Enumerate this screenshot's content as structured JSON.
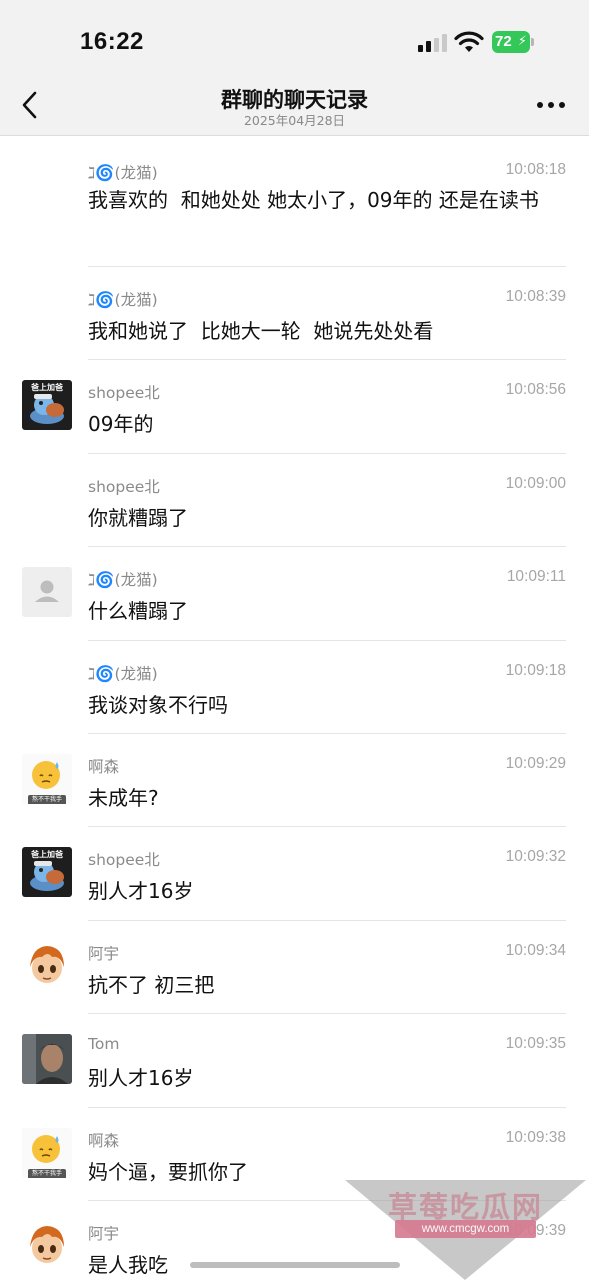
{
  "status_bar": {
    "time": "16:22",
    "battery": "72"
  },
  "nav": {
    "title": "群聊的聊天记录",
    "subtitle": "2025年04月28日"
  },
  "messages": [
    {
      "sender": "ℷ🌀(龙猫)",
      "time": "10:08:18",
      "text": "我喜欢的  和她处处 她太小了，09年的 还是在读书",
      "avatar": "none"
    },
    {
      "sender": "ℷ🌀(龙猫)",
      "time": "10:08:39",
      "text": "我和她说了  比她大一轮  她说先处处看",
      "avatar": "none"
    },
    {
      "sender": "shopee北",
      "time": "10:08:56",
      "text": "09年的",
      "avatar": "shopee-avatar"
    },
    {
      "sender": "shopee北",
      "time": "10:09:00",
      "text": "你就糟蹋了",
      "avatar": "none"
    },
    {
      "sender": "ℷ🌀(龙猫)",
      "time": "10:09:11",
      "text": "什么糟蹋了",
      "avatar": "default-avatar"
    },
    {
      "sender": "ℷ🌀(龙猫)",
      "time": "10:09:18",
      "text": "我谈对象不行吗",
      "avatar": "none"
    },
    {
      "sender": "啊森",
      "time": "10:09:29",
      "text": "未成年?",
      "avatar": "emoji-avatar"
    },
    {
      "sender": "shopee北",
      "time": "10:09:32",
      "text": "别人才16岁",
      "avatar": "shopee-avatar"
    },
    {
      "sender": "阿宇",
      "time": "10:09:34",
      "text": "抗不了 初三把",
      "avatar": "anime-avatar"
    },
    {
      "sender": "Tom",
      "time": "10:09:35",
      "text": "别人才16岁",
      "avatar": "photo-avatar"
    },
    {
      "sender": "啊森",
      "time": "10:09:38",
      "text": "妈个逼，要抓你了",
      "avatar": "emoji-avatar"
    },
    {
      "sender": "阿宇",
      "time": "10:09:39",
      "text": "是人我吃",
      "avatar": "anime-avatar"
    }
  ],
  "avatar_captions": {
    "shopee": "爸上加爸",
    "emoji": "熬不干我手"
  },
  "watermark": {
    "title": "草莓吃瓜网",
    "url": "www.cmcgw.com"
  },
  "colors": {
    "header_bg": "#f2f2f2",
    "battery": "#34c759",
    "watermark": "#d67a90"
  }
}
